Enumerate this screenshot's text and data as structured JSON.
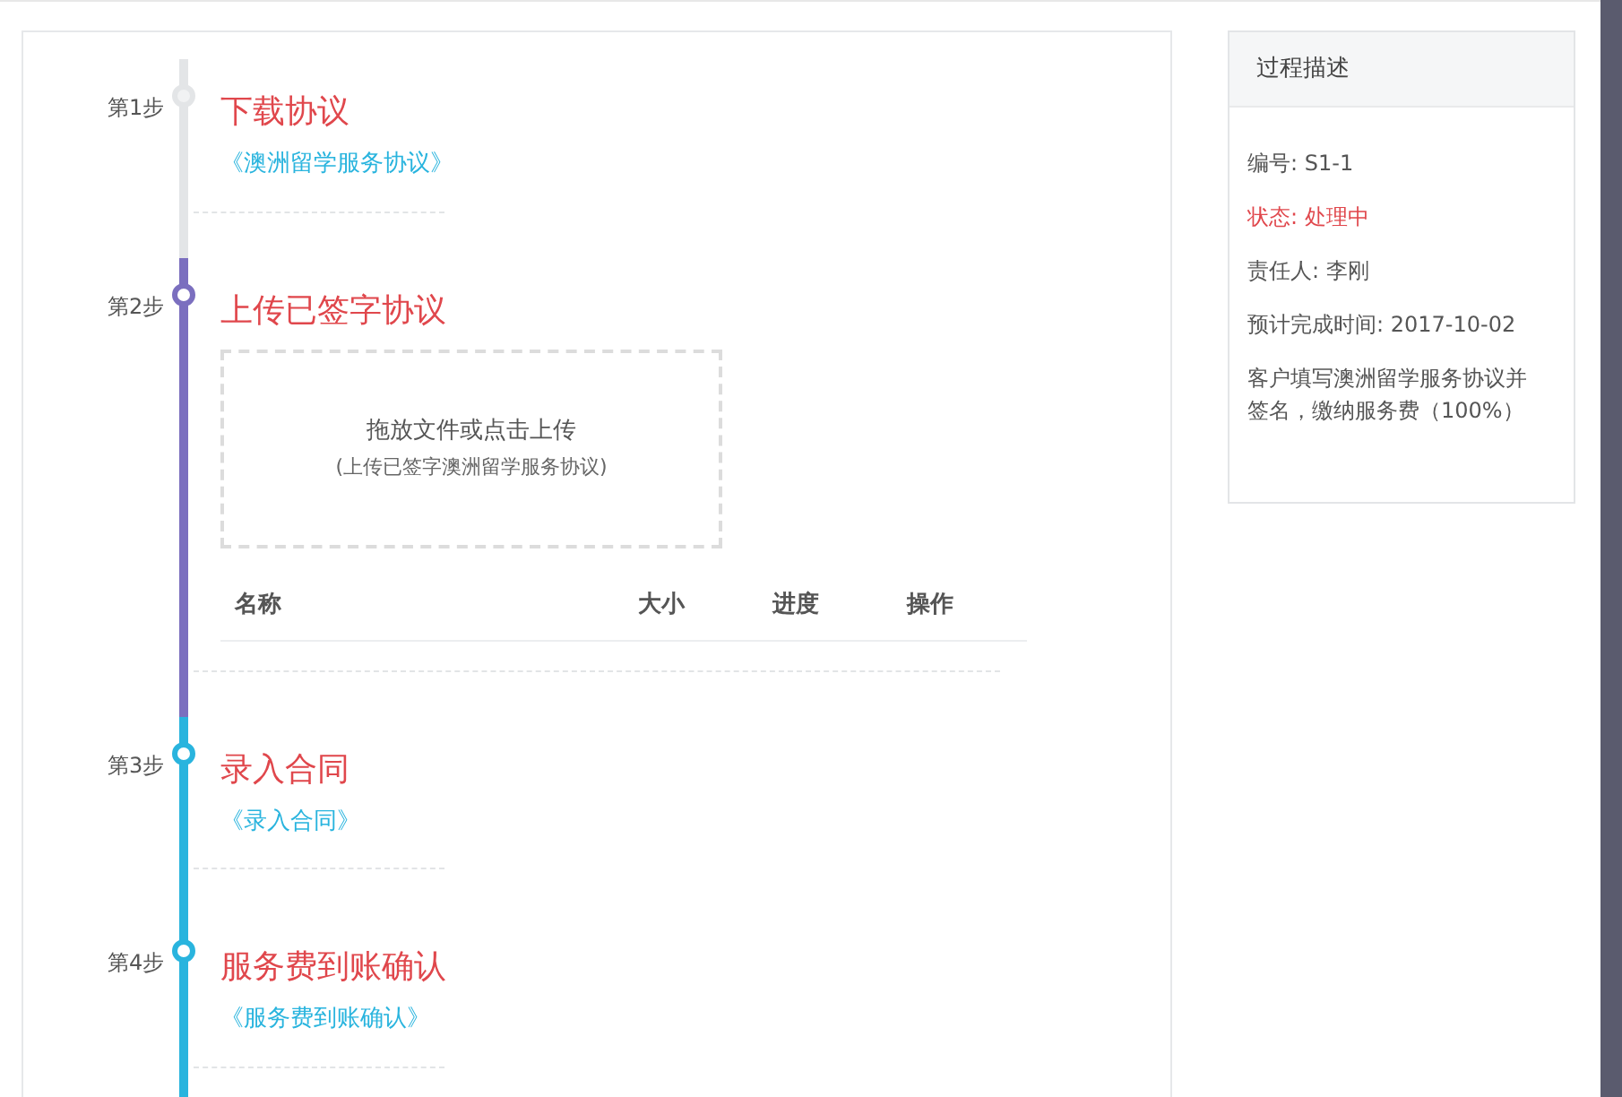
{
  "steps": [
    {
      "label": "第1步",
      "kind": "done",
      "title": "下载协议",
      "link": "《澳洲留学服务协议》"
    },
    {
      "label": "第2步",
      "kind": "active",
      "title": "上传已签字协议",
      "upload": {
        "prompt": "拖放文件或点击上传",
        "hint": "(上传已签字澳洲留学服务协议)"
      },
      "table": {
        "columns": [
          "名称",
          "大小",
          "进度",
          "操作"
        ]
      }
    },
    {
      "label": "第3步",
      "kind": "pending",
      "title": "录入合同",
      "link": "《录入合同》"
    },
    {
      "label": "第4步",
      "kind": "pending",
      "title": "服务费到账确认",
      "link": "《服务费到账确认》"
    }
  ],
  "panel": {
    "title": "过程描述",
    "rows": [
      {
        "text": "编号: S1-1",
        "kind": "normal"
      },
      {
        "text": "状态: 处理中",
        "kind": "alert"
      },
      {
        "text": "责任人: 李刚",
        "kind": "normal"
      },
      {
        "text": "预计完成时间: 2017-10-02",
        "kind": "normal"
      },
      {
        "text": "客户填写澳洲留学服务协议并签名，缴纳服务费（100%）",
        "kind": "normal"
      }
    ]
  }
}
